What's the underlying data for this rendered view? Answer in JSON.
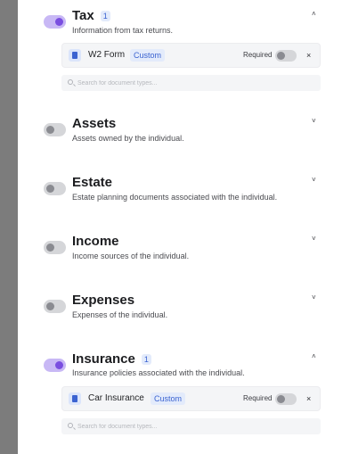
{
  "sections": [
    {
      "key": "tax",
      "title": "Tax",
      "count": "1",
      "description": "Information from tax returns.",
      "enabled": true,
      "expanded": true,
      "chevron": "˄",
      "document": {
        "name": "W2 Form",
        "tag": "Custom",
        "required_label": "Required",
        "remove": "×"
      },
      "search_placeholder": "Search for document types..."
    },
    {
      "key": "assets",
      "title": "Assets",
      "description": "Assets owned by the individual.",
      "enabled": false,
      "chevron": "˅"
    },
    {
      "key": "estate",
      "title": "Estate",
      "description": "Estate planning documents associated with the individual.",
      "enabled": false,
      "chevron": "˅"
    },
    {
      "key": "income",
      "title": "Income",
      "description": "Income sources of the individual.",
      "enabled": false,
      "chevron": "˅"
    },
    {
      "key": "expenses",
      "title": "Expenses",
      "description": "Expenses of the individual.",
      "enabled": false,
      "chevron": "˅"
    },
    {
      "key": "insurance",
      "title": "Insurance",
      "count": "1",
      "description": "Insurance policies associated with the individual.",
      "enabled": true,
      "expanded": true,
      "chevron": "˄",
      "document": {
        "name": "Car Insurance",
        "tag": "Custom",
        "required_label": "Required",
        "remove": "×"
      },
      "search_placeholder": "Search for document types..."
    }
  ],
  "colors": {
    "toggle_on_track": "#c8b8f5",
    "toggle_on_knob": "#7a4ee0",
    "toggle_off_track": "#d5d6d9",
    "badge_text": "#3b63d1",
    "badge_bg": "#e3ebfb"
  },
  "icons": {
    "document": "document-icon",
    "search": "search-icon",
    "remove": "close-icon",
    "expand": "chevron-down-icon",
    "collapse": "chevron-up-icon"
  }
}
